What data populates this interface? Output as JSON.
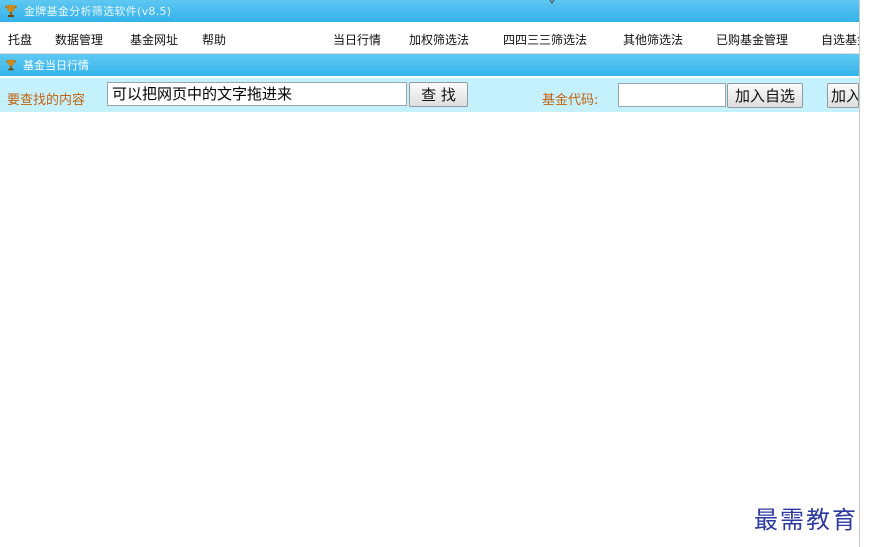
{
  "window": {
    "title": "金牌基金分析筛选软件(v8.5)",
    "app_icon": "trophy-icon",
    "accent_color": "#36b4eb"
  },
  "menu": {
    "items": [
      {
        "label": "托盘"
      },
      {
        "label": "数据管理"
      },
      {
        "label": "基金网址"
      },
      {
        "label": "帮助"
      },
      {
        "label": "当日行情"
      },
      {
        "label": "加权筛选法"
      },
      {
        "label": "四四三三筛选法"
      },
      {
        "label": "其他筛选法"
      },
      {
        "label": "已购基金管理"
      },
      {
        "label": "自选基金"
      }
    ]
  },
  "subwindow": {
    "title": "基金当日行情"
  },
  "search": {
    "label": "要查找的内容",
    "value": "可以把网页中的文字拖进来",
    "find_button": "查 找",
    "code_label": "基金代码:",
    "code_value": "",
    "add_favorite_button": "加入自选",
    "add_button": "加入"
  },
  "watermark": {
    "text": "最需教育"
  }
}
